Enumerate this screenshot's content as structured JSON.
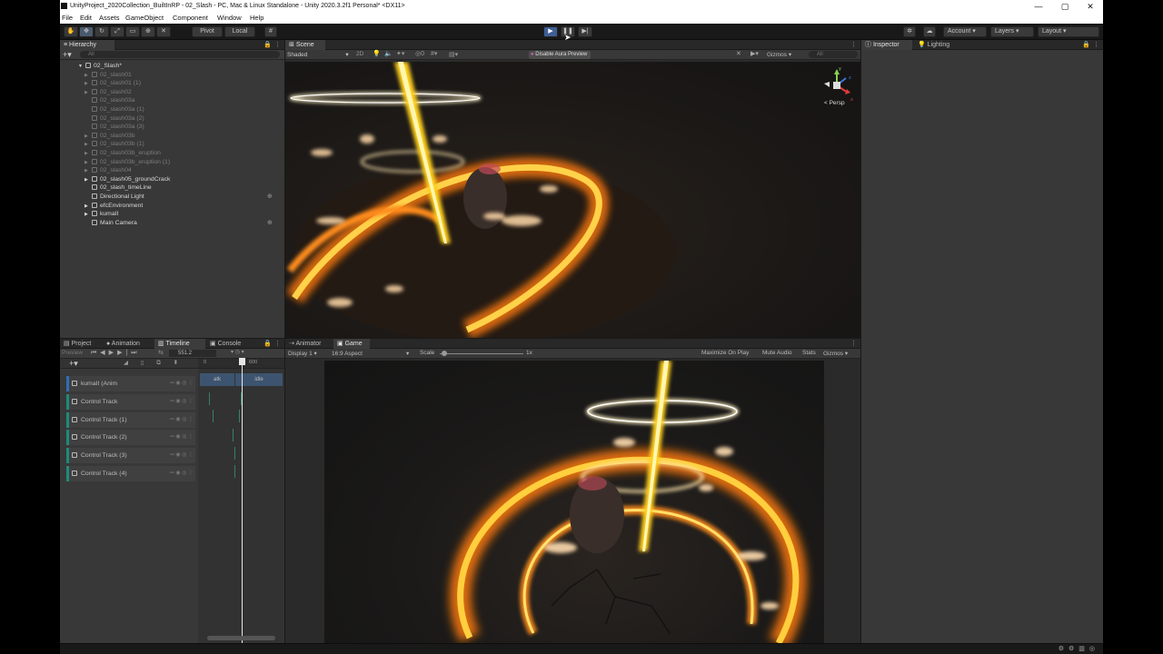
{
  "window": {
    "title": "UnityProject_2020Collection_BuiltInRP - 02_Slash - PC, Mac & Linux Standalone - Unity 2020.3.2f1 Personal* <DX11>",
    "controls": [
      "—",
      "▢",
      "✕"
    ]
  },
  "menu": [
    "File",
    "Edit",
    "Assets",
    "GameObject",
    "Component",
    "Window",
    "Help"
  ],
  "toolbar": {
    "pivot_label": "Pivot",
    "local_label": "Local",
    "account_label": "Account",
    "layers_label": "Layers",
    "layout_label": "Layout"
  },
  "hierarchy": {
    "tab": "Hierarchy",
    "search_placeholder": "All",
    "root": "02_Slash*",
    "items": [
      {
        "label": "02_slash01",
        "dim": true,
        "expandable": true
      },
      {
        "label": "02_slash01 (1)",
        "dim": true,
        "expandable": true
      },
      {
        "label": "02_slash02",
        "dim": true,
        "expandable": true
      },
      {
        "label": "02_slash03a",
        "dim": true,
        "expandable": false
      },
      {
        "label": "02_slash03a (1)",
        "dim": true,
        "expandable": false
      },
      {
        "label": "02_slash03a (2)",
        "dim": true,
        "expandable": false
      },
      {
        "label": "02_slash03a (3)",
        "dim": true,
        "expandable": false
      },
      {
        "label": "02_slash03b",
        "dim": true,
        "expandable": true
      },
      {
        "label": "02_slash03b (1)",
        "dim": true,
        "expandable": true
      },
      {
        "label": "02_slash03b_eruption",
        "dim": true,
        "expandable": true
      },
      {
        "label": "02_slash03b_eruption (1)",
        "dim": true,
        "expandable": true
      },
      {
        "label": "02_slash04",
        "dim": true,
        "expandable": true
      },
      {
        "label": "02_slash05_groundCrack",
        "dim": false,
        "expandable": true
      },
      {
        "label": "02_slash_timeLine",
        "dim": false,
        "expandable": false
      },
      {
        "label": "Directional Light",
        "dim": false,
        "expandable": false
      },
      {
        "label": "efcEnvironment",
        "dim": false,
        "expandable": true
      },
      {
        "label": "kumaII",
        "dim": false,
        "expandable": true
      },
      {
        "label": "Main Camera",
        "dim": false,
        "expandable": false
      }
    ]
  },
  "scene": {
    "tab": "Scene",
    "shading": "Shaded",
    "mode_2d": "2D",
    "aura_label": "Disable Aura Preview",
    "gizmos_label": "Gizmos",
    "search_placeholder": "All",
    "persp_label": "< Persp",
    "gizmo_axes": [
      "y",
      "x",
      "z"
    ]
  },
  "inspector": {
    "tabs": [
      "Inspector",
      "Lighting"
    ]
  },
  "bottom_tabs": [
    "Project",
    "Animation",
    "Timeline",
    "Console"
  ],
  "timeline": {
    "preview_label": "Preview",
    "frame_value": "551.2",
    "ruler_labels": [
      "0",
      "600"
    ],
    "clip_labels": [
      "atk",
      "idle"
    ],
    "tracks": [
      "kumaII (Anim",
      "Control Track",
      "Control Track (1)",
      "Control Track (2)",
      "Control Track (3)",
      "Control Track (4)"
    ]
  },
  "game": {
    "tabs": [
      "Animator",
      "Game"
    ],
    "display": "Display 1",
    "aspect": "16:9 Aspect",
    "scale_label": "Scale",
    "scale_value": "1x",
    "options": [
      "Maximize On Play",
      "Mute Audio",
      "Stats",
      "Gizmos"
    ]
  },
  "colors": {
    "accent_blue": "#3e5f96",
    "track_teal": "#1f8a7a",
    "fire_orange": "#ff8a12",
    "fire_yellow": "#ffd23a"
  }
}
